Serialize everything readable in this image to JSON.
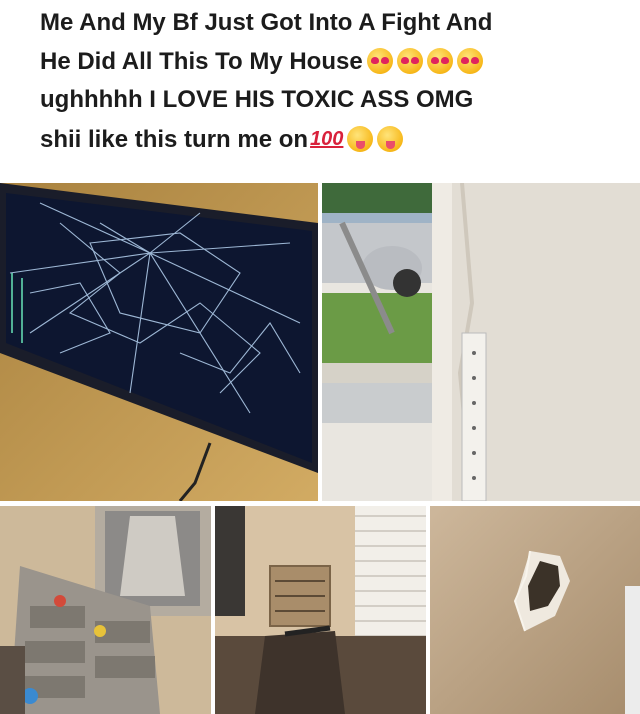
{
  "post": {
    "line1": "Me And My Bf Just Got Into A Fight And",
    "line2": "He Did All This To My House",
    "line3": "ughhhhh I LOVE HIS TOXIC ASS OMG",
    "line4": "shii like this turn me on",
    "hundred": "100",
    "emojis_line2": [
      "heart-eyes-emoji",
      "heart-eyes-emoji",
      "heart-eyes-emoji",
      "heart-eyes-emoji"
    ],
    "emojis_line4": [
      "hundred-points-emoji",
      "tongue-emoji",
      "tongue-emoji"
    ]
  },
  "photos": [
    {
      "name": "photo-broken-tv"
    },
    {
      "name": "photo-broken-door-frame"
    },
    {
      "name": "photo-damaged-dresser"
    },
    {
      "name": "photo-broken-vent-and-blinds"
    },
    {
      "name": "photo-hole-in-wall"
    }
  ]
}
